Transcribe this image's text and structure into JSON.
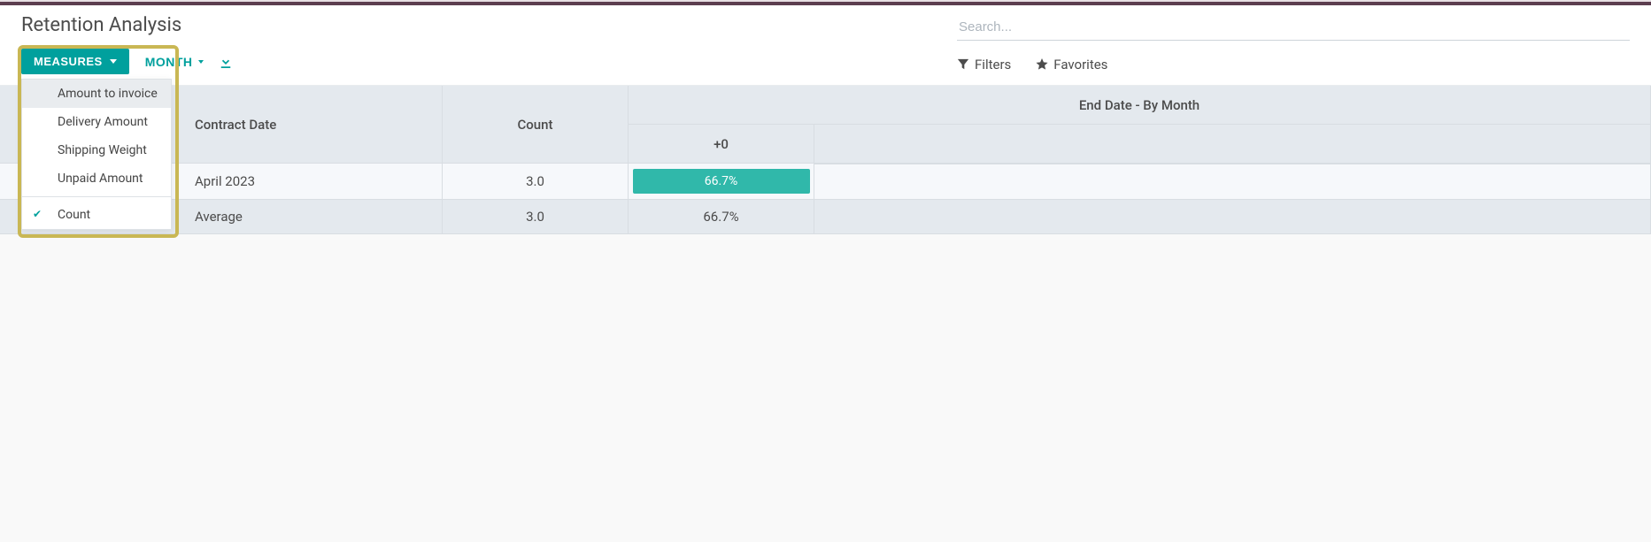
{
  "page": {
    "title": "Retention Analysis"
  },
  "toolbar": {
    "measures_label": "MEASURES",
    "month_label": "MONTH"
  },
  "search": {
    "placeholder": "Search...",
    "filters_label": "Filters",
    "favorites_label": "Favorites"
  },
  "measures_menu": {
    "items": [
      {
        "label": "Amount to invoice",
        "checked": false,
        "hovered": true
      },
      {
        "label": "Delivery Amount",
        "checked": false,
        "hovered": false
      },
      {
        "label": "Shipping Weight",
        "checked": false,
        "hovered": false
      },
      {
        "label": "Unpaid Amount",
        "checked": false,
        "hovered": false
      }
    ],
    "count_label": "Count",
    "count_checked": true
  },
  "table": {
    "contract_date_header": "Contract Date",
    "count_header": "Count",
    "end_group_header": "End Date - By Month",
    "plus0_header": "+0",
    "rows": [
      {
        "label": "April 2023",
        "count": "3.0",
        "chip": "66.7%"
      }
    ],
    "avg_label": "Average",
    "avg_count": "3.0",
    "avg_pct": "66.7%"
  }
}
